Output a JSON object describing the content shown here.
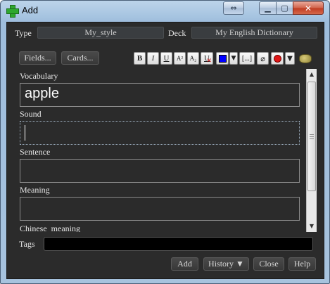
{
  "window": {
    "title": "Add"
  },
  "top": {
    "type_label": "Type",
    "type_value": "My_style",
    "deck_label": "Deck",
    "deck_value": "My English Dictionary"
  },
  "toolbar": {
    "fields_button": "Fields...",
    "cards_button": "Cards...",
    "bold": "B",
    "italic": "I",
    "underline": "U",
    "superscript": "A²",
    "subscript": "A₂",
    "clear_format": "U",
    "cloze": "[...]",
    "text_color": "#0000ff"
  },
  "fields": [
    {
      "label": "Vocabulary",
      "value": "apple"
    },
    {
      "label": "Sound",
      "value": ""
    },
    {
      "label": "Sentence",
      "value": ""
    },
    {
      "label": "Meaning",
      "value": ""
    },
    {
      "label": "Chinese_meaning",
      "value": ""
    }
  ],
  "tags": {
    "label": "Tags",
    "value": ""
  },
  "bottom": {
    "add_button": "Add",
    "history_button": "History ▼",
    "close_button": "Close",
    "help_button": "Help"
  }
}
